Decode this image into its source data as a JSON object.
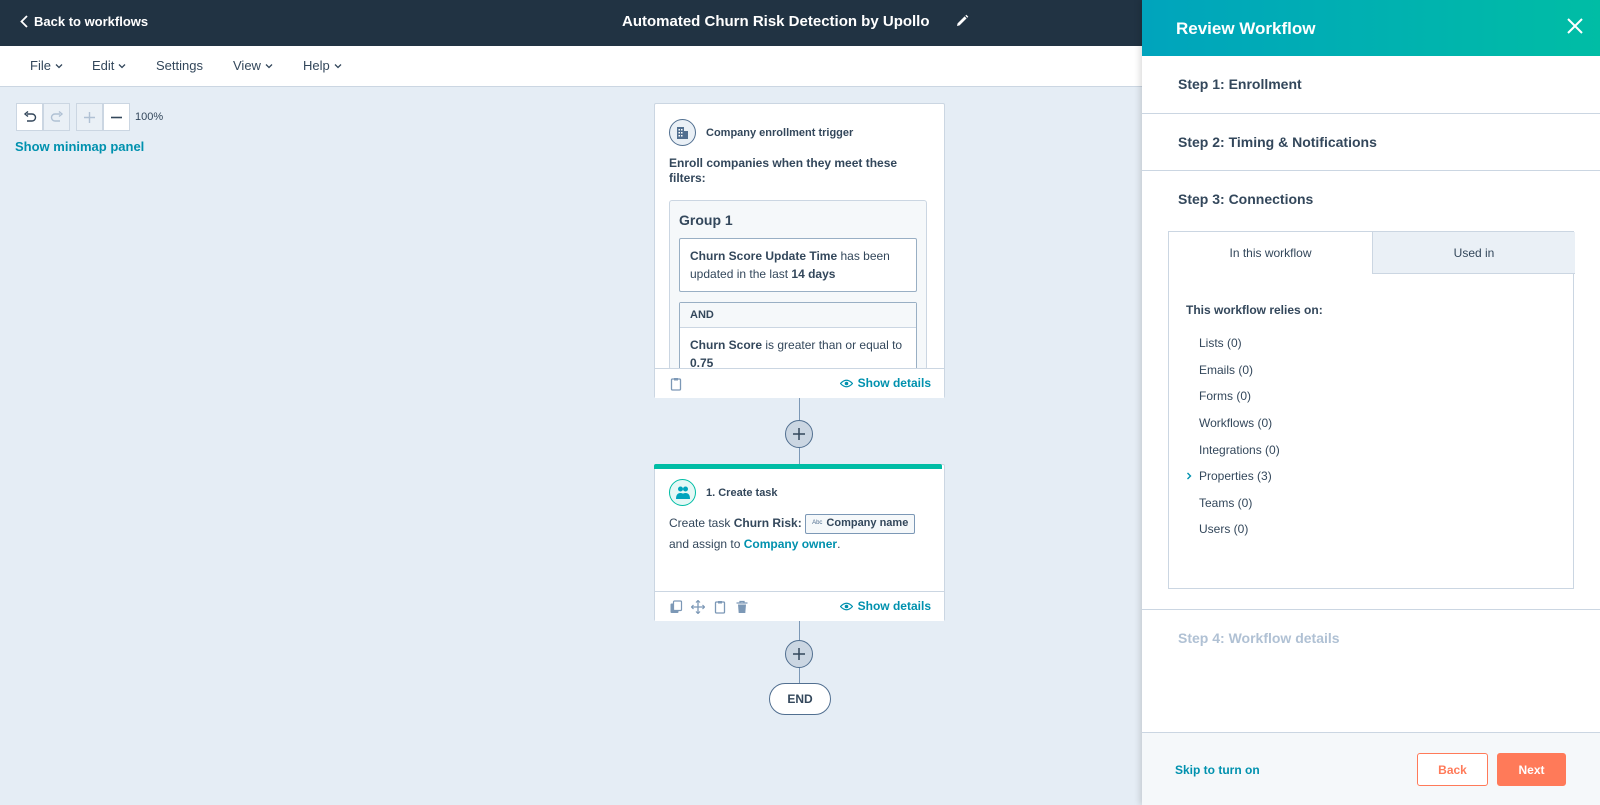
{
  "header": {
    "back_label": "Back to workflows",
    "title": "Automated Churn Risk Detection by Upollo"
  },
  "menu": [
    "File",
    "Edit",
    "Settings",
    "View",
    "Help"
  ],
  "canvas": {
    "zoom_level": "100%",
    "minimap_label": "Show minimap panel"
  },
  "trigger_card": {
    "title": "Company enrollment trigger",
    "description": "Enroll companies when they meet these filters:",
    "group_title": "Group 1",
    "filter1_property": "Churn Score Update Time",
    "filter1_text1": " has been updated in the last ",
    "filter1_value": "14 days",
    "and_label": "AND",
    "filter2_property": "Churn Score",
    "filter2_text": " is greater than or equal to ",
    "filter2_value": "0.75",
    "show_details": "Show details"
  },
  "task_card": {
    "title": "1. Create task",
    "text_prefix": "Create task ",
    "task_name": "Churn Risk:",
    "token_type": "Abc",
    "token_label": "Company name",
    "assign_text": "and assign to ",
    "assignee": "Company owner",
    "period": ".",
    "show_details": "Show details"
  },
  "end_label": "END",
  "panel": {
    "title": "Review Workflow",
    "steps": [
      "Step 1: Enrollment",
      "Step 2: Timing & Notifications",
      "Step 3: Connections",
      "Step 4: Workflow details"
    ],
    "tabs": [
      "In this workflow",
      "Used in"
    ],
    "relies_on_label": "This workflow relies on:",
    "dependencies": [
      "Lists (0)",
      "Emails (0)",
      "Forms (0)",
      "Workflows (0)",
      "Integrations (0)",
      "Properties (3)",
      "Teams (0)",
      "Users (0)"
    ],
    "skip_label": "Skip to turn on",
    "back_label": "Back",
    "next_label": "Next"
  },
  "colors": {
    "header_bg": "#213343",
    "canvas_bg": "#e5edf5",
    "link": "#0091ae",
    "accent_teal": "#00bda5",
    "cta_orange": "#ff7a59"
  }
}
